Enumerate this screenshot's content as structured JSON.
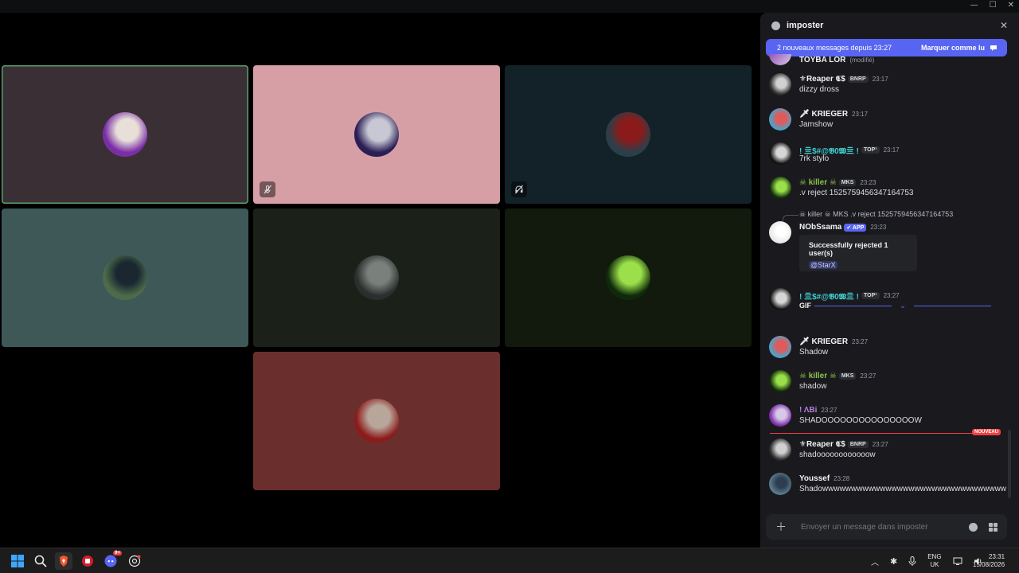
{
  "window": {
    "controls": [
      "—",
      "☐",
      "✕"
    ]
  },
  "tiles": [
    {
      "id": "t1",
      "bg": "#3b2f36",
      "speaking": true,
      "avatar": "purple-aura-man",
      "avatar_colors": [
        "#7a2ea6",
        "#e7dfd8"
      ]
    },
    {
      "id": "t2",
      "bg": "#d69ea5",
      "speaking": false,
      "avatar": "anime-skull",
      "avatar_colors": [
        "#2a1e55",
        "#c8c8d4"
      ],
      "badge": "mic-muted-icon"
    },
    {
      "id": "t3",
      "bg": "#132229",
      "speaking": false,
      "avatar": "dark-red-figure",
      "avatar_colors": [
        "#2b3f4a",
        "#8b1a1a"
      ],
      "badge": "deafened-icon"
    },
    {
      "id": "t4",
      "bg": "#3e5858",
      "speaking": false,
      "avatar": "car-landscape",
      "avatar_colors": [
        "#4b6b4a",
        "#1a2630"
      ]
    },
    {
      "id": "t5",
      "bg": "#1b2119",
      "speaking": false,
      "avatar": "white-bird-car",
      "avatar_colors": [
        "#2a2e2c",
        "#7a807c"
      ]
    },
    {
      "id": "t6",
      "bg": "#111a0c",
      "speaking": false,
      "avatar": "killerafk-logo",
      "avatar_colors": [
        "#0f2a0a",
        "#9be04a"
      ]
    },
    {
      "id": "t7",
      "bg": "#6a2f2d",
      "speaking": false,
      "avatar": "long-hair-girl",
      "avatar_colors": [
        "#8b1c1c",
        "#b9a69a"
      ]
    }
  ],
  "chat": {
    "channel": "imposter",
    "new_messages": "2 nouveaux messages depuis 23:27",
    "mark_read": "Marquer comme lu",
    "top_partial": {
      "name": "TOYBA LOR",
      "edited": "(modifié)"
    },
    "messages": [
      {
        "name": "⚜Reaper 𝕮$",
        "name_color": "#f2f3f5",
        "tags": [
          "BNRP"
        ],
        "ts": "23:17",
        "text": "dizzy dross",
        "av": [
          "#2a2a2a",
          "#d0d0d0"
        ]
      },
      {
        "name": "🗡 KRIEGER",
        "name_color": "#f2f3f5",
        "tags": [],
        "ts": "23:17",
        "text": "Jamshow",
        "av": [
          "#4aa3c9",
          "#e05a5a"
        ]
      },
      {
        "name": "! 亖$#@𝕭0𝖂亖 !",
        "name_color": "#3ecfcf",
        "tags": [
          "TOP¹"
        ],
        "ts": "23:17",
        "text": "7rk stylo",
        "av": [
          "#101010",
          "#d6d6d6"
        ]
      },
      {
        "name": "☠ killer ☠",
        "name_color": "#8bc34a",
        "tags": [
          "MKS"
        ],
        "ts": "23:23",
        "text": ".v reject 1525759456347164753",
        "av": [
          "#0f2a0a",
          "#9be04a"
        ]
      },
      {
        "name": "NObSsama",
        "name_color": "#f2f3f5",
        "tags": [
          "✔ APP"
        ],
        "ts": "23:23",
        "reply": "☠ killer ☠ MKS .v reject 1525759456347164753",
        "embed_title": "Successfully rejected 1 user(s)",
        "embed_mention": "@StarX",
        "av": [
          "#e8e8e8",
          "#ffffff"
        ]
      },
      {
        "name": "! 亖$#@𝕭0𝖂亖 !",
        "name_color": "#3ecfcf",
        "tags": [
          "TOP¹"
        ],
        "ts": "23:27",
        "gif": "GIF",
        "av": [
          "#101010",
          "#d6d6d6"
        ]
      },
      {
        "name": "🗡 KRIEGER",
        "name_color": "#f2f3f5",
        "tags": [],
        "ts": "23:27",
        "text": "Shadow",
        "av": [
          "#4aa3c9",
          "#e05a5a"
        ]
      },
      {
        "name": "☠ killer ☠",
        "name_color": "#8bc34a",
        "tags": [
          "MKS"
        ],
        "ts": "23:27",
        "text": "shadow",
        "av": [
          "#0f2a0a",
          "#9be04a"
        ]
      },
      {
        "name": "! ΛBi",
        "name_color": "#b57edc",
        "tags": [],
        "ts": "23:27",
        "text": "SHADOOOOOOOOOOOOOOOW",
        "av": [
          "#7a2ea6",
          "#d8c8e8"
        ]
      },
      {
        "name": "⚜Reaper 𝕮$",
        "name_color": "#f2f3f5",
        "tags": [
          "BNRP"
        ],
        "ts": "23:27",
        "text": "shadoooooooooooow",
        "av": [
          "#2a2a2a",
          "#d0d0d0"
        ]
      },
      {
        "name": "Youssef",
        "name_color": "#f2f3f5",
        "tags": [],
        "ts": "23:28",
        "text": "Shadowwwwwwwwwwwwwwwwwwwwwwwwwwwwwwww",
        "av": [
          "#5a7a8a",
          "#2c3e50"
        ]
      }
    ],
    "new_label": "NOUVEAU",
    "composer_placeholder": "Envoyer un message dans imposter"
  },
  "taskbar": {
    "apps": [
      "windows-start-icon",
      "search-icon",
      "brave-browser-icon",
      "red-app-icon",
      "discord-icon",
      "chatgpt-icon"
    ],
    "discord_badge": "9+",
    "lang_top": "ENG",
    "lang_bottom": "UK",
    "time": "23:31",
    "date": "15/08/2026"
  },
  "colors": {
    "accent": "#5865f2",
    "danger": "#f23f43",
    "speaking": "#57a06a"
  }
}
